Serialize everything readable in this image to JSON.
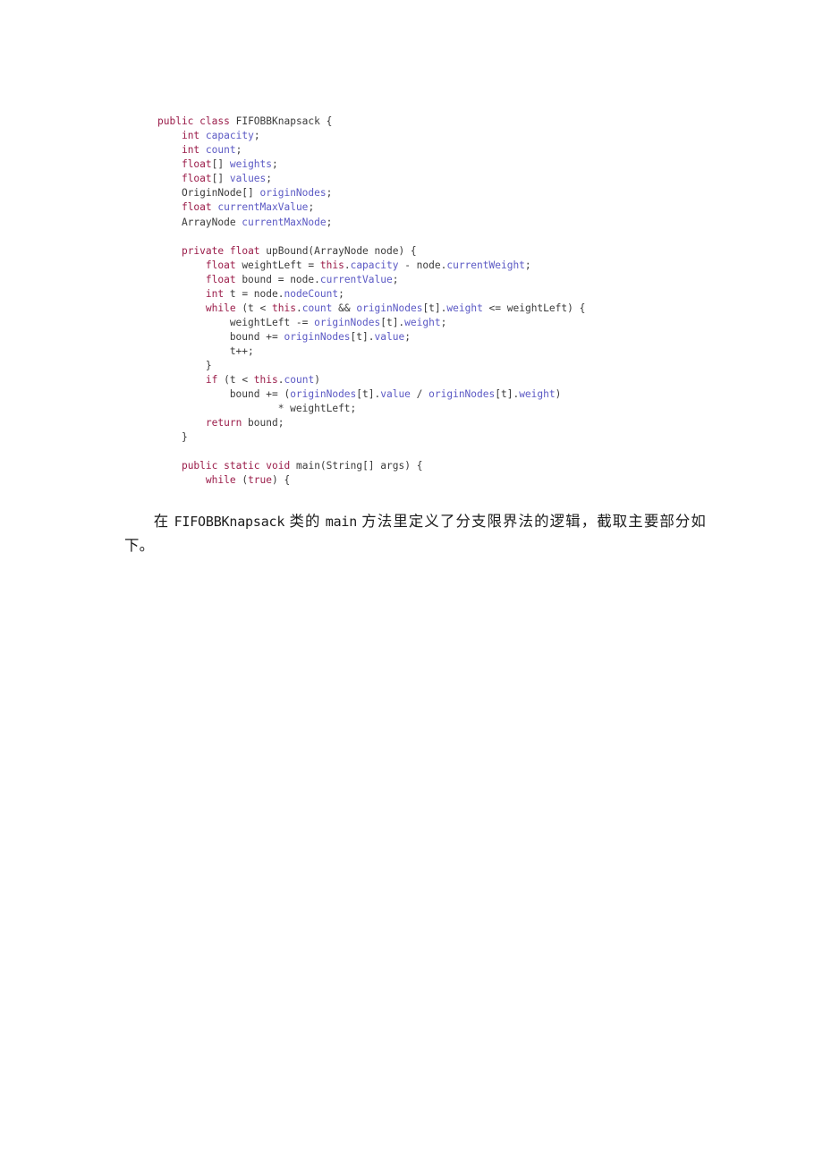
{
  "document": {
    "page_background": "#ffffff",
    "colors": {
      "keyword": "#9b1d4a",
      "field": "#5b59c4",
      "plain": "#3a3a3a",
      "body_text": "#1c1c1c"
    }
  },
  "code_block": {
    "language": "java",
    "class_name": "FIFOBBKnapsack",
    "lines": [
      {
        "id": "line-01",
        "tokens": [
          {
            "t": "public",
            "c": "kw"
          },
          {
            "t": " ",
            "c": "pln"
          },
          {
            "t": "class",
            "c": "kw"
          },
          {
            "t": " FIFOBBKnapsack {",
            "c": "pln"
          }
        ]
      },
      {
        "id": "line-02",
        "tokens": [
          {
            "t": "    ",
            "c": "pln"
          },
          {
            "t": "int",
            "c": "kw"
          },
          {
            "t": " ",
            "c": "pln"
          },
          {
            "t": "capacity",
            "c": "fld"
          },
          {
            "t": ";",
            "c": "pln"
          }
        ]
      },
      {
        "id": "line-03",
        "tokens": [
          {
            "t": "    ",
            "c": "pln"
          },
          {
            "t": "int",
            "c": "kw"
          },
          {
            "t": " ",
            "c": "pln"
          },
          {
            "t": "count",
            "c": "fld"
          },
          {
            "t": ";",
            "c": "pln"
          }
        ]
      },
      {
        "id": "line-04",
        "tokens": [
          {
            "t": "    ",
            "c": "pln"
          },
          {
            "t": "float",
            "c": "kw"
          },
          {
            "t": "[] ",
            "c": "pln"
          },
          {
            "t": "weights",
            "c": "fld"
          },
          {
            "t": ";",
            "c": "pln"
          }
        ]
      },
      {
        "id": "line-05",
        "tokens": [
          {
            "t": "    ",
            "c": "pln"
          },
          {
            "t": "float",
            "c": "kw"
          },
          {
            "t": "[] ",
            "c": "pln"
          },
          {
            "t": "values",
            "c": "fld"
          },
          {
            "t": ";",
            "c": "pln"
          }
        ]
      },
      {
        "id": "line-06",
        "tokens": [
          {
            "t": "    OriginNode[] ",
            "c": "pln"
          },
          {
            "t": "originNodes",
            "c": "fld"
          },
          {
            "t": ";",
            "c": "pln"
          }
        ]
      },
      {
        "id": "line-07",
        "tokens": [
          {
            "t": "    ",
            "c": "pln"
          },
          {
            "t": "float",
            "c": "kw"
          },
          {
            "t": " ",
            "c": "pln"
          },
          {
            "t": "currentMaxValue",
            "c": "fld"
          },
          {
            "t": ";",
            "c": "pln"
          }
        ]
      },
      {
        "id": "line-08",
        "tokens": [
          {
            "t": "    ArrayNode ",
            "c": "pln"
          },
          {
            "t": "currentMaxNode",
            "c": "fld"
          },
          {
            "t": ";",
            "c": "pln"
          }
        ]
      },
      {
        "id": "line-09",
        "tokens": []
      },
      {
        "id": "line-10",
        "tokens": [
          {
            "t": "    ",
            "c": "pln"
          },
          {
            "t": "private",
            "c": "kw"
          },
          {
            "t": " ",
            "c": "pln"
          },
          {
            "t": "float",
            "c": "kw"
          },
          {
            "t": " upBound(ArrayNode node) {",
            "c": "pln"
          }
        ]
      },
      {
        "id": "line-11",
        "tokens": [
          {
            "t": "        ",
            "c": "pln"
          },
          {
            "t": "float",
            "c": "kw"
          },
          {
            "t": " weightLeft = ",
            "c": "pln"
          },
          {
            "t": "this",
            "c": "kw"
          },
          {
            "t": ".",
            "c": "pln"
          },
          {
            "t": "capacity",
            "c": "fld"
          },
          {
            "t": " - node.",
            "c": "pln"
          },
          {
            "t": "currentWeight",
            "c": "fld"
          },
          {
            "t": ";",
            "c": "pln"
          }
        ]
      },
      {
        "id": "line-12",
        "tokens": [
          {
            "t": "        ",
            "c": "pln"
          },
          {
            "t": "float",
            "c": "kw"
          },
          {
            "t": " bound = node.",
            "c": "pln"
          },
          {
            "t": "currentValue",
            "c": "fld"
          },
          {
            "t": ";",
            "c": "pln"
          }
        ]
      },
      {
        "id": "line-13",
        "tokens": [
          {
            "t": "        ",
            "c": "pln"
          },
          {
            "t": "int",
            "c": "kw"
          },
          {
            "t": " t = node.",
            "c": "pln"
          },
          {
            "t": "nodeCount",
            "c": "fld"
          },
          {
            "t": ";",
            "c": "pln"
          }
        ]
      },
      {
        "id": "line-14",
        "tokens": [
          {
            "t": "        ",
            "c": "pln"
          },
          {
            "t": "while",
            "c": "kw"
          },
          {
            "t": " (t < ",
            "c": "pln"
          },
          {
            "t": "this",
            "c": "kw"
          },
          {
            "t": ".",
            "c": "pln"
          },
          {
            "t": "count",
            "c": "fld"
          },
          {
            "t": " && ",
            "c": "pln"
          },
          {
            "t": "originNodes",
            "c": "fld"
          },
          {
            "t": "[t].",
            "c": "pln"
          },
          {
            "t": "weight",
            "c": "fld"
          },
          {
            "t": " <= weightLeft) {",
            "c": "pln"
          }
        ]
      },
      {
        "id": "line-15",
        "tokens": [
          {
            "t": "            weightLeft -= ",
            "c": "pln"
          },
          {
            "t": "originNodes",
            "c": "fld"
          },
          {
            "t": "[t].",
            "c": "pln"
          },
          {
            "t": "weight",
            "c": "fld"
          },
          {
            "t": ";",
            "c": "pln"
          }
        ]
      },
      {
        "id": "line-16",
        "tokens": [
          {
            "t": "            bound += ",
            "c": "pln"
          },
          {
            "t": "originNodes",
            "c": "fld"
          },
          {
            "t": "[t].",
            "c": "pln"
          },
          {
            "t": "value",
            "c": "fld"
          },
          {
            "t": ";",
            "c": "pln"
          }
        ]
      },
      {
        "id": "line-17",
        "tokens": [
          {
            "t": "            t++;",
            "c": "pln"
          }
        ]
      },
      {
        "id": "line-18",
        "tokens": [
          {
            "t": "        }",
            "c": "pln"
          }
        ]
      },
      {
        "id": "line-19",
        "tokens": [
          {
            "t": "        ",
            "c": "pln"
          },
          {
            "t": "if",
            "c": "kw"
          },
          {
            "t": " (t < ",
            "c": "pln"
          },
          {
            "t": "this",
            "c": "kw"
          },
          {
            "t": ".",
            "c": "pln"
          },
          {
            "t": "count",
            "c": "fld"
          },
          {
            "t": ")",
            "c": "pln"
          }
        ]
      },
      {
        "id": "line-20",
        "tokens": [
          {
            "t": "            bound += (",
            "c": "pln"
          },
          {
            "t": "originNodes",
            "c": "fld"
          },
          {
            "t": "[t].",
            "c": "pln"
          },
          {
            "t": "value",
            "c": "fld"
          },
          {
            "t": " / ",
            "c": "pln"
          },
          {
            "t": "originNodes",
            "c": "fld"
          },
          {
            "t": "[t].",
            "c": "pln"
          },
          {
            "t": "weight",
            "c": "fld"
          },
          {
            "t": ")",
            "c": "pln"
          }
        ]
      },
      {
        "id": "line-21",
        "tokens": [
          {
            "t": "                    * weightLeft;",
            "c": "pln"
          }
        ]
      },
      {
        "id": "line-22",
        "tokens": [
          {
            "t": "        ",
            "c": "pln"
          },
          {
            "t": "return",
            "c": "kw"
          },
          {
            "t": " bound;",
            "c": "pln"
          }
        ]
      },
      {
        "id": "line-23",
        "tokens": [
          {
            "t": "    }",
            "c": "pln"
          }
        ]
      },
      {
        "id": "line-24",
        "tokens": []
      },
      {
        "id": "line-25",
        "tokens": [
          {
            "t": "    ",
            "c": "pln"
          },
          {
            "t": "public",
            "c": "kw"
          },
          {
            "t": " ",
            "c": "pln"
          },
          {
            "t": "static",
            "c": "kw"
          },
          {
            "t": " ",
            "c": "pln"
          },
          {
            "t": "void",
            "c": "kw"
          },
          {
            "t": " main(String[] args) {",
            "c": "pln"
          }
        ]
      },
      {
        "id": "line-26",
        "tokens": [
          {
            "t": "        ",
            "c": "pln"
          },
          {
            "t": "while",
            "c": "kw"
          },
          {
            "t": " (",
            "c": "pln"
          },
          {
            "t": "true",
            "c": "kw"
          },
          {
            "t": ") {",
            "c": "pln"
          }
        ]
      }
    ]
  },
  "paragraph": {
    "id": "paragraph-1",
    "runs": [
      {
        "t": "在 ",
        "mono": false
      },
      {
        "t": "FIFOBBKnapsack",
        "mono": true
      },
      {
        "t": " 类的 ",
        "mono": false
      },
      {
        "t": "main",
        "mono": true
      },
      {
        "t": " 方法里定义了分支限界法的逻辑，截取主要部分如下。",
        "mono": false
      }
    ],
    "plain_text": "在 FIFOBBKnapsack 类的 main 方法里定义了分支限界法的逻辑，截取主要部分如下。"
  }
}
